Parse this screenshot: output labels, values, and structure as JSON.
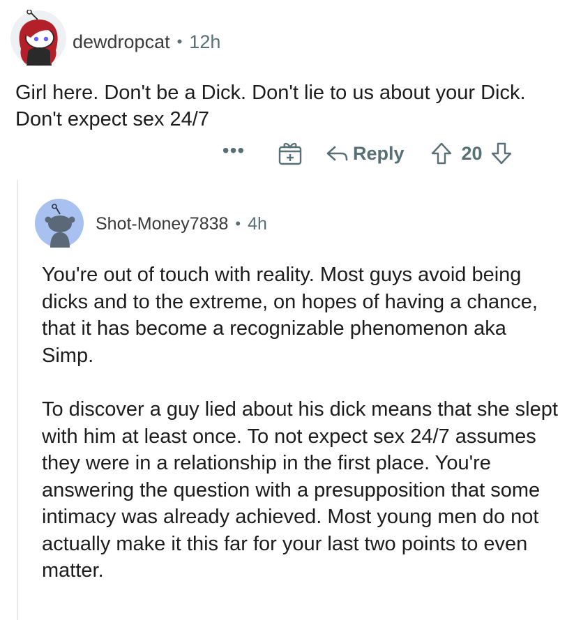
{
  "parent_comment": {
    "username": "dewdropcat",
    "separator": "•",
    "time": "12h",
    "body": "Girl here.  Don't be a Dick. Don't lie to us about your Dick. Don't expect sex 24/7",
    "actions": {
      "more_label": "•••",
      "reply_label": "Reply",
      "score": "20"
    }
  },
  "reply_comment": {
    "username": "Shot-Money7838",
    "separator": "•",
    "time": "4h",
    "paragraphs": [
      "You're out of touch with reality. Most guys avoid being dicks and to the extreme, on hopes of having a chance, that it has become a recognizable phenomenon aka Simp.",
      "To discover a guy lied about his dick means that she slept with him at least once. To not expect sex 24/7 assumes they were in a relationship in the first place. You're answering the question with a presupposition that some intimacy was already achieved. Most young men do not actually make it this far for your last two points to even matter."
    ]
  },
  "colors": {
    "text": "#1c1c1c",
    "meta": "#576f76",
    "thread_line": "#e5ebee",
    "snoo_blue_bg": "#a8c1f0",
    "avatar_hair": "#b3202a"
  },
  "icons": [
    "more-icon",
    "award-icon",
    "reply-icon",
    "upvote-icon",
    "downvote-icon"
  ]
}
